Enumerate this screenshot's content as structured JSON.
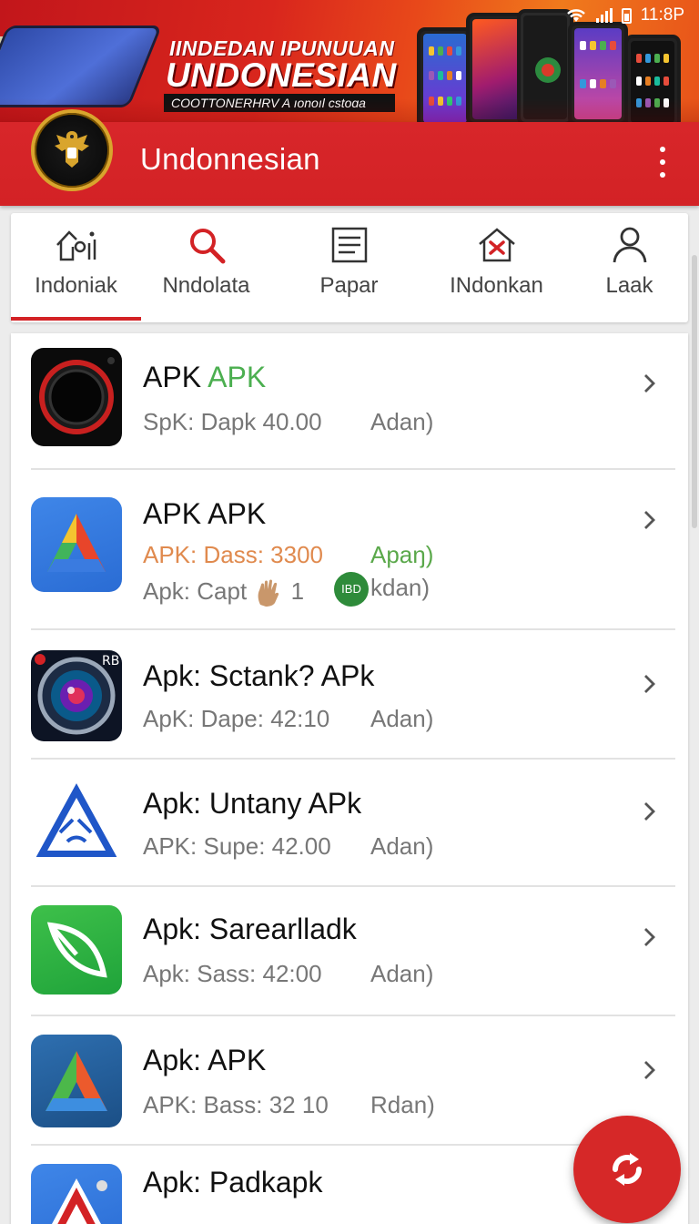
{
  "status_bar": {
    "time": "11:8P"
  },
  "banner": {
    "line1": "IINDEDAN IPUNUUAN",
    "line2": "UNDONESIAN",
    "line3": "COOTTONERHRV A ıonoıl cstoɑa"
  },
  "appbar": {
    "title": "Undonnesian"
  },
  "tabs": [
    {
      "label": "Indoniak",
      "icon": "home-chart-icon",
      "active": true
    },
    {
      "label": "Nndolata",
      "icon": "search-icon",
      "active": false
    },
    {
      "label": "Papar",
      "icon": "document-icon",
      "active": false
    },
    {
      "label": "INdonkan",
      "icon": "house-tools-icon",
      "active": false
    },
    {
      "label": "Laak",
      "icon": "person-icon",
      "active": false
    }
  ],
  "apps": [
    {
      "title_a": "APK ",
      "title_b": "APK",
      "sub_left": "SpK: Dapk 40.00",
      "sub_right": "Adan)"
    },
    {
      "title_a": "APK APK",
      "sub_left": "APK: Dass: 3300",
      "sub_right": "Apaŋ)",
      "extra_left": "Apk: Capt",
      "extra_count": "1",
      "extra_badge": "IBD",
      "extra_right": "kdan)"
    },
    {
      "title_a": "Apk: Sctank? APk",
      "sub_left": "ApK: Dape: 42:10",
      "sub_right": "Adan)"
    },
    {
      "title_a": "Apk: Untany APk",
      "sub_left": "APK: Supe: 42.00",
      "sub_right": "Adan)"
    },
    {
      "title_a": "Apk: Sarearlladk",
      "sub_left": "Apk: Sass: 42:00",
      "sub_right": "Adan)"
    },
    {
      "title_a": "Apk: APK",
      "sub_left": "APK: Bass: 32 10",
      "sub_right": "Rdan)"
    },
    {
      "title_a": "Apk: Padkapk"
    }
  ],
  "colors": {
    "primary": "#d32225",
    "accent_green": "#4caf50",
    "orange": "#e08a4e"
  }
}
